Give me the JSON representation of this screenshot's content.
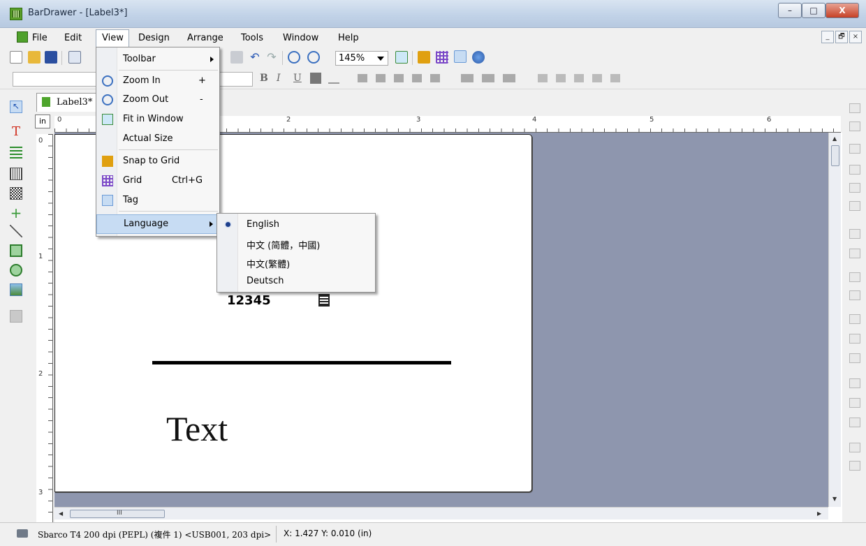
{
  "window": {
    "title": "BarDrawer - [Label3*]",
    "minimize_label": "–",
    "maximize_label": "□",
    "close_label": "X"
  },
  "menubar": {
    "items": [
      "File",
      "Edit",
      "View",
      "Design",
      "Arrange",
      "Tools",
      "Window",
      "Help"
    ]
  },
  "mdi_controls": {
    "minimize": "_",
    "restore": "🗗",
    "close": "×"
  },
  "toolbar": {
    "zoom_value": "145%"
  },
  "document": {
    "tab_label": "Label3*",
    "ruler_unit": "in",
    "hruler_numbers": [
      "0",
      "1",
      "2",
      "3",
      "4",
      "5",
      "6"
    ],
    "vruler_numbers": [
      "0",
      "1",
      "2",
      "3"
    ],
    "barcode_number": "12345",
    "text_object": "Text"
  },
  "view_menu": {
    "items": [
      {
        "label": "Toolbar",
        "shortcut": "",
        "submenu": true
      },
      {
        "label": "Zoom In",
        "shortcut": "+",
        "icon": "zoom-in-icon"
      },
      {
        "label": "Zoom Out",
        "shortcut": "-",
        "icon": "zoom-out-icon"
      },
      {
        "label": "Fit in Window",
        "shortcut": "",
        "icon": "fit-window-icon"
      },
      {
        "label": "Actual Size",
        "shortcut": ""
      },
      {
        "label": "Snap to Grid",
        "shortcut": "",
        "icon": "snap-grid-icon"
      },
      {
        "label": "Grid",
        "shortcut": "Ctrl+G",
        "icon": "grid-icon"
      },
      {
        "label": "Tag",
        "shortcut": "",
        "icon": "tag-icon"
      },
      {
        "label": "Language",
        "shortcut": "",
        "submenu": true,
        "highlighted": true
      }
    ]
  },
  "language_menu": {
    "items": [
      {
        "label": "English",
        "selected": true
      },
      {
        "label": "中文 (简體，中國)"
      },
      {
        "label": "中文(繁體)"
      },
      {
        "label": "Deutsch"
      }
    ]
  },
  "status": {
    "printer": "Sbarco T4 200 dpi (PEPL) (複件 1) <USB001, 203 dpi>",
    "coords": "X: 1.427  Y: 0.010 (in)"
  },
  "hscroll": {
    "grip": "III"
  },
  "colors": {
    "canvas": "#8e96ae",
    "menu_highlight": "#c7dcf3",
    "app_icon": "#5a9e2a"
  }
}
